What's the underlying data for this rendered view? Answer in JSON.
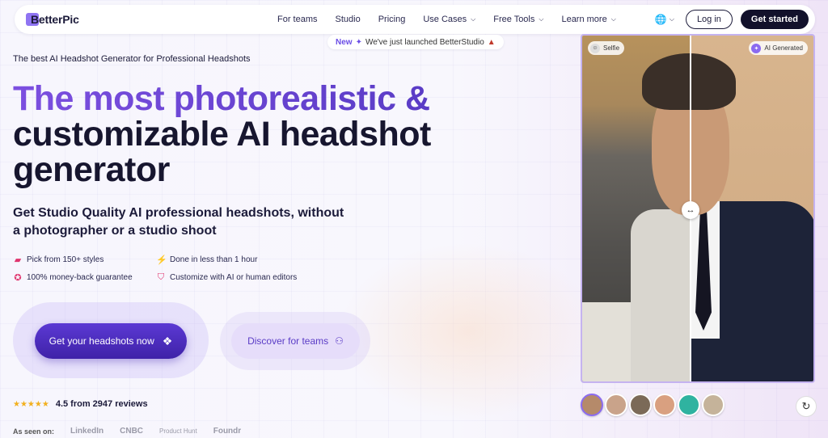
{
  "brand": {
    "name": "BetterPic"
  },
  "nav": {
    "links": [
      {
        "label": "For teams",
        "dropdown": false
      },
      {
        "label": "Studio",
        "dropdown": false
      },
      {
        "label": "Pricing",
        "dropdown": false
      },
      {
        "label": "Use Cases",
        "dropdown": true
      },
      {
        "label": "Free Tools",
        "dropdown": true
      },
      {
        "label": "Learn more",
        "dropdown": true
      }
    ],
    "language_icon": "globe-icon",
    "login_label": "Log in",
    "cta_label": "Get started"
  },
  "announcement": {
    "badge": "New",
    "text": "We've just launched BetterStudio"
  },
  "hero": {
    "tagline": "The best AI Headshot Generator for Professional Headshots",
    "headline_gradient": "The most photorealistic &",
    "headline_rest": "customizable AI headshot generator",
    "subheadline": "Get Studio Quality AI professional headshots, without a photographer or a studio shoot",
    "features": [
      {
        "icon": "styles-icon",
        "glyph": "▰",
        "text": "Pick from 150+ styles"
      },
      {
        "icon": "lightning-icon",
        "glyph": "⚡",
        "text": "Done in less than 1 hour"
      },
      {
        "icon": "award-icon",
        "glyph": "✪",
        "text": "100% money-back guarantee"
      },
      {
        "icon": "shield-icon",
        "glyph": "⛉",
        "text": "Customize with AI or human editors"
      }
    ],
    "primary_cta": "Get your headshots now",
    "secondary_cta": "Discover for teams"
  },
  "reviews": {
    "rating": 4.5,
    "text": "4.5 from 2947 reviews",
    "stars": "★★★★★"
  },
  "as_seen_on": {
    "label": "As seen on:",
    "outlets": [
      "LinkedIn",
      "CNBC",
      "Product Hunt",
      "Foundr"
    ]
  },
  "comparison": {
    "left_label": "Selfie",
    "right_label": "AI Generated",
    "colors": {
      "accent": "#8b6bf0",
      "primary_button": "#4a2bbf",
      "dark_button": "#12112b"
    }
  },
  "avatars": [
    {
      "color": "#b58a6a"
    },
    {
      "color": "#c9a38a"
    },
    {
      "color": "#7b6a58"
    },
    {
      "color": "#d9a080"
    },
    {
      "color": "#2fb3a0"
    },
    {
      "color": "#c5b39a"
    }
  ]
}
